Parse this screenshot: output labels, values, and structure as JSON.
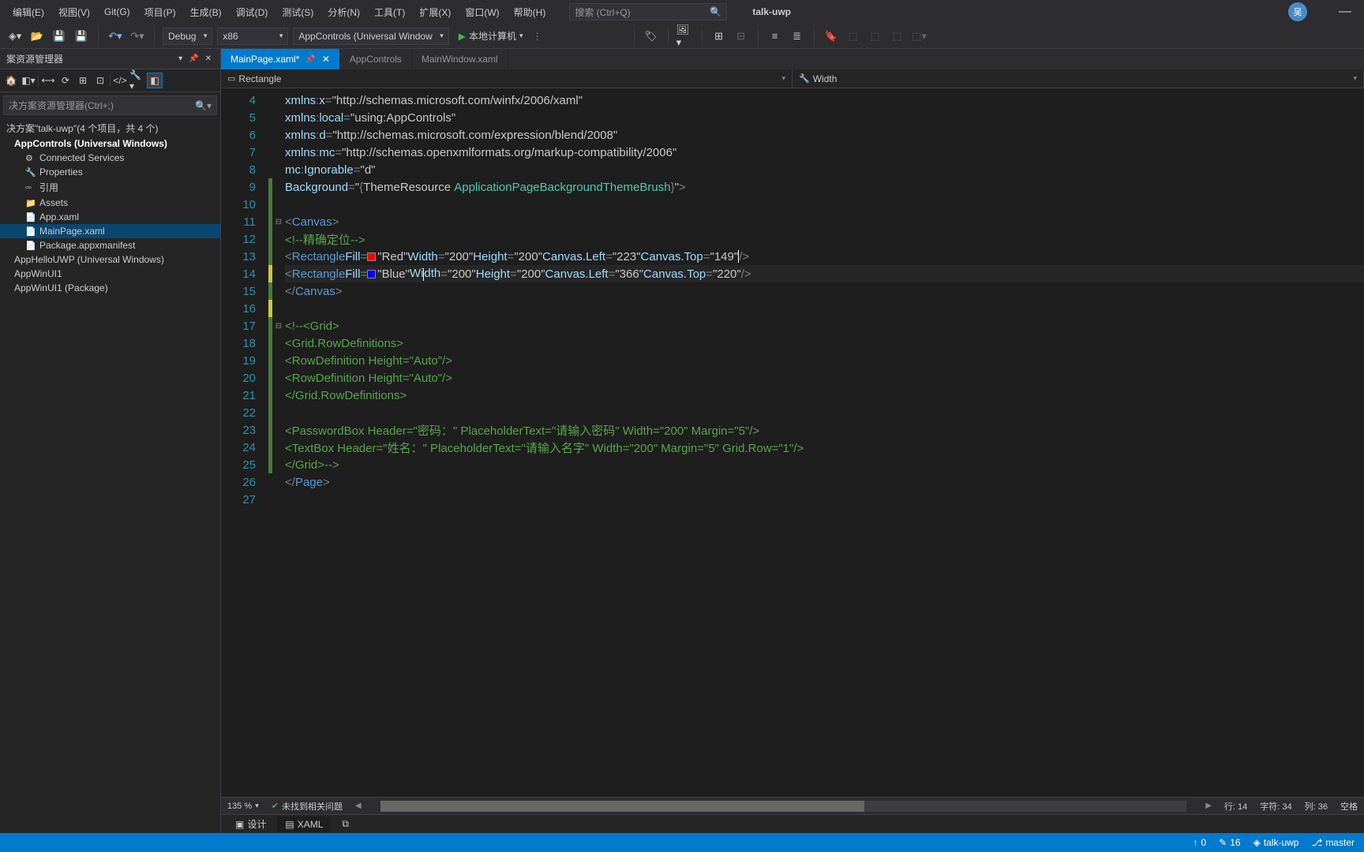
{
  "menu": {
    "items": [
      "编辑(E)",
      "视图(V)",
      "Git(G)",
      "项目(P)",
      "生成(B)",
      "调试(D)",
      "测试(S)",
      "分析(N)",
      "工具(T)",
      "扩展(X)",
      "窗口(W)",
      "帮助(H)"
    ]
  },
  "search": {
    "placeholder": "搜索 (Ctrl+Q)"
  },
  "title": "talk-uwp",
  "user": "吴",
  "toolbar": {
    "config": "Debug",
    "platform": "x86",
    "target": "AppControls (Universal Window",
    "run": "本地计算机"
  },
  "explorer": {
    "header": "案资源管理器",
    "search": "决方案资源管理器(Ctrl+;)",
    "solution": "决方案\"talk-uwp\"(4 个项目，共 4 个)",
    "proj1": "AppControls (Universal Windows)",
    "items1": [
      "Connected Services",
      "Properties",
      "引用",
      "Assets",
      "App.xaml",
      "MainPage.xaml",
      "Package.appxmanifest"
    ],
    "proj2": "AppHelloUWP (Universal Windows)",
    "proj3": "AppWinUI1",
    "proj4": "AppWinUI1 (Package)"
  },
  "tabs": [
    {
      "label": "MainPage.xaml*",
      "active": true
    },
    {
      "label": "AppControls",
      "active": false
    },
    {
      "label": "MainWindow.xaml",
      "active": false
    }
  ],
  "nav": {
    "left": "Rectangle",
    "right": "Width"
  },
  "lines": {
    "start": 4,
    "end": 27
  },
  "footer": {
    "zoom": "135 %",
    "issues": "未找到相关问题",
    "line": "行: 14",
    "char": "字符: 34",
    "col": "列: 36",
    "mode": "空格"
  },
  "bottom_tabs": {
    "design": "设计",
    "xaml": "XAML"
  },
  "statusbar": {
    "up": "0",
    "down": "16",
    "repo": "talk-uwp",
    "branch": "master"
  }
}
